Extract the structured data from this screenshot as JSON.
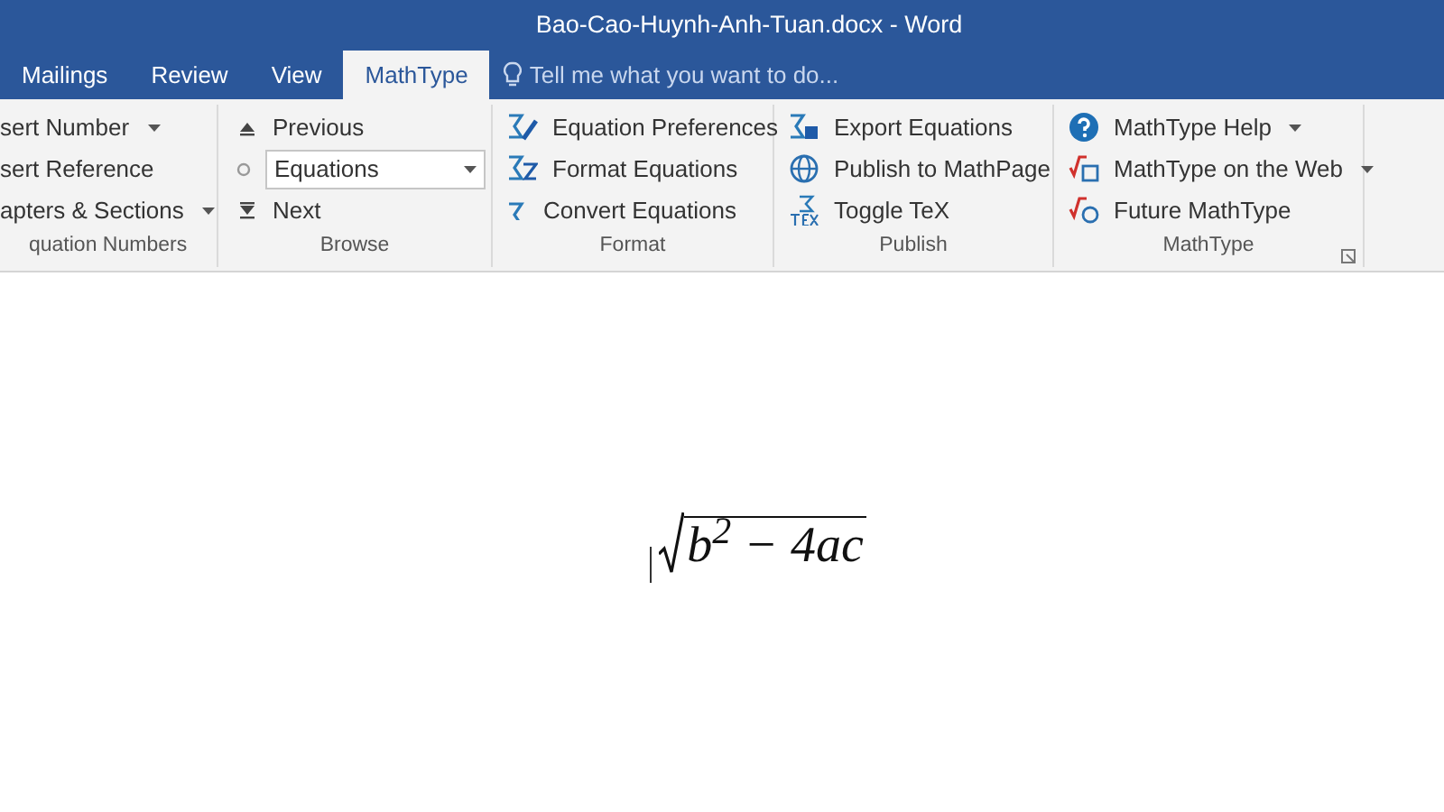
{
  "window": {
    "title": "Bao-Cao-Huynh-Anh-Tuan.docx - Word"
  },
  "tabs": [
    {
      "label": "Mailings",
      "selected": false
    },
    {
      "label": "Review",
      "selected": false
    },
    {
      "label": "View",
      "selected": false
    },
    {
      "label": "MathType",
      "selected": true
    }
  ],
  "tell_me": {
    "placeholder": "Tell me what you want to do..."
  },
  "ribbon_groups": [
    {
      "label": "quation Numbers",
      "items": [
        {
          "kind": "button",
          "label": "sert Number",
          "dropdown": true
        },
        {
          "kind": "button",
          "label": "sert Reference",
          "dropdown": false
        },
        {
          "kind": "button",
          "label": "apters & Sections",
          "dropdown": true
        }
      ]
    },
    {
      "label": "Browse",
      "items": [
        {
          "kind": "button",
          "label": "Previous",
          "dropdown": false
        },
        {
          "kind": "combo",
          "value": "Equations"
        },
        {
          "kind": "button",
          "label": "Next",
          "dropdown": false
        }
      ]
    },
    {
      "label": "Format",
      "items": [
        {
          "kind": "button",
          "label": "Equation Preferences",
          "dropdown": false
        },
        {
          "kind": "button",
          "label": "Format Equations",
          "dropdown": false
        },
        {
          "kind": "button",
          "label": "Convert Equations",
          "dropdown": false
        }
      ]
    },
    {
      "label": "Publish",
      "items": [
        {
          "kind": "button",
          "label": "Export Equations",
          "dropdown": false
        },
        {
          "kind": "button",
          "label": "Publish to MathPage",
          "dropdown": false
        },
        {
          "kind": "button",
          "label": "Toggle TeX",
          "dropdown": false
        }
      ]
    },
    {
      "label": "MathType",
      "launcher": true,
      "items": [
        {
          "kind": "button",
          "label": "MathType Help",
          "dropdown": true
        },
        {
          "kind": "button",
          "label": "MathType on the Web",
          "dropdown": true
        },
        {
          "kind": "button",
          "label": "Future MathType",
          "dropdown": false
        }
      ]
    }
  ],
  "document": {
    "equation": "b$^{2}$ − 4ac"
  }
}
